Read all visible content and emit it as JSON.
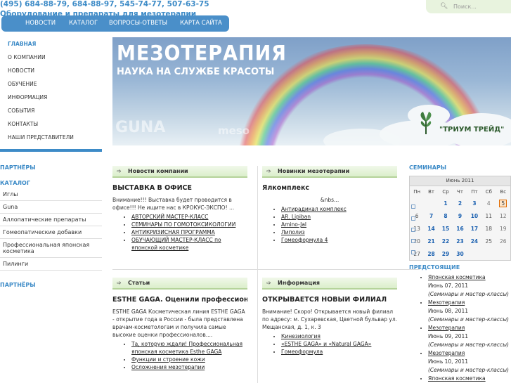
{
  "header": {
    "phone": "(495) 684-88-79, 684-88-97, 545-74-77, 507-63-75",
    "tagline": "Оборудование и препараты для мезотерапии",
    "search_placeholder": "Поиск..."
  },
  "topnav": [
    "НОВОСТИ",
    "КАТАЛОГ",
    "ВОПРОСЫ-ОТВЕТЫ",
    "КАРТА САЙТА"
  ],
  "leftmenu": [
    "ГЛАВНАЯ",
    "О КОМПАНИИ",
    "НОВОСТИ",
    "ОБУЧЕНИЕ",
    "ИНФОРМАЦИЯ",
    "СОБЫТИЯ",
    "КОНТАКТЫ",
    "НАШИ ПРЕДСТАВИТЕЛИ"
  ],
  "partners_label": "ПАРТНЁРЫ",
  "catalog_label": "КАТАЛОГ",
  "catalog": [
    "Иглы",
    "Guna",
    "Аллопатические препараты",
    "Гомеопатические добавки",
    "Профессиональная японская косметика",
    "Пилинги"
  ],
  "banner": {
    "title": "МЕЗОТЕРАПИЯ",
    "subtitle": "НАУКА НА СЛУЖБЕ КРАСОТЫ",
    "brand1": "GUNA",
    "brand2": "meso",
    "brand3": "\"ТРИУМ ТРЕЙД\""
  },
  "blocks": {
    "news": {
      "header": "Новости компании",
      "title": "ВЫСТАВКА В ОФИСЕ",
      "text": "Внимание!!! Выставка будет проводится в офисе!!! Не ищите нас в КРОКУС-ЭКСПО! ...",
      "links": [
        "АВТОРСКИЙ МАСТЕР-КЛАСС",
        "СЕМИНАРЫ ПО ГОМОТОКСИКОЛОГИИ",
        "АНТИКРИЗИСНАЯ ПРОГРАММА",
        "ОБУЧАЮЩИЙ МАСТЕР-КЛАСС по японской косметике"
      ]
    },
    "meso": {
      "header": "Новинки мезотерапии",
      "title": "Ялкомплекс",
      "text": "&nbs...",
      "links": [
        "Антирадикал комплекс",
        "AR. Lipiban",
        "Amino-Jal",
        "Липолиз",
        "Гомеоформула 4"
      ]
    },
    "articles": {
      "header": "Статьи",
      "title": "ESTHE GAGA. Оценили профессионалы",
      "text": "ESTHE GAGA Косметическая линия ESTHE GAGA - открытие года в России - была представлена врачам-косметологам и получила самые высокие оценки профессионалов....",
      "links": [
        "Та, которую ждали! Профессиональная японская косметика Esthe GAGA",
        "Функции и строение кожи",
        "Осложнения мезотерапии"
      ]
    },
    "info": {
      "header": "Информация",
      "title": "ОТКРЫВАЕТСЯ НОВЫЙ ФИЛИАЛ",
      "text": "Внимание! Скоро! Открывается новый филиал по адресу: м. Сухаревская, Цветной бульвар ул. Мещанская, д. 1, к. 3",
      "links": [
        "Кинезиология",
        "«ESTHE GAGA» и «Natural GAGA»",
        "Гомеоформула"
      ]
    }
  },
  "right": {
    "seminars_label": "СЕМИНАРЫ",
    "calendar_month": "Июнь 2011",
    "weekdays": [
      "Пн",
      "Вт",
      "Ср",
      "Чт",
      "Пт",
      "Сб",
      "Вс"
    ],
    "weeks": [
      [
        "",
        "",
        "1",
        "2",
        "3",
        "4",
        "5"
      ],
      [
        "6",
        "7",
        "8",
        "9",
        "10",
        "11",
        "12"
      ],
      [
        "13",
        "14",
        "15",
        "16",
        "17",
        "18",
        "19"
      ],
      [
        "20",
        "21",
        "22",
        "23",
        "24",
        "25",
        "26"
      ],
      [
        "27",
        "28",
        "29",
        "30",
        "",
        "",
        ""
      ]
    ],
    "today": "5",
    "upcoming_label": "ПРЕДСТОЯЩИЕ",
    "events": [
      {
        "name": "Японская косметика",
        "date": "Июнь 07, 2011",
        "cat": "(Семинары и мастер-классы)"
      },
      {
        "name": "Мезотерапия",
        "date": "Июнь 08, 2011",
        "cat": "(Семинары и мастер-классы)"
      },
      {
        "name": "Мезотерапия",
        "date": "Июнь 09, 2011",
        "cat": "(Семинары и мастер-классы)"
      },
      {
        "name": "Мезотерапия",
        "date": "Июнь 10, 2011",
        "cat": "(Семинары и мастер-классы)"
      },
      {
        "name": "Японская косметика",
        "date": "",
        "cat": ""
      }
    ]
  },
  "colors": {
    "accent": "#3d8bc7",
    "nav_bg": "#4a8fc9",
    "block_header": "#dbeecb"
  }
}
